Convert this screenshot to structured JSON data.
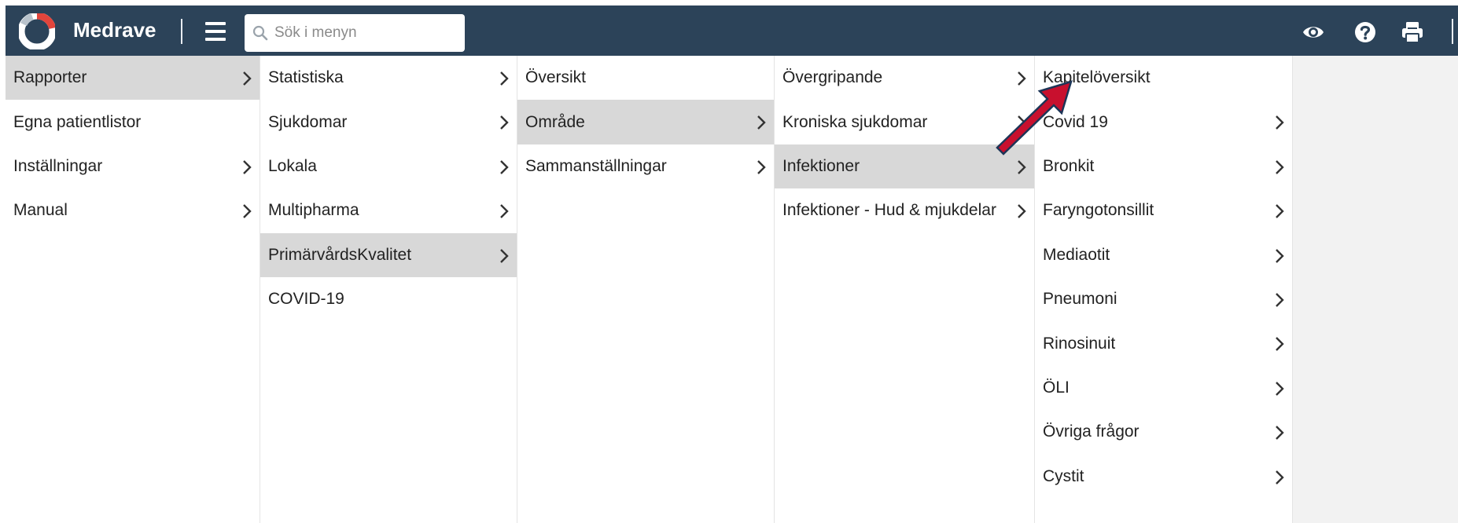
{
  "header": {
    "brand": "Medrave",
    "search_placeholder": "Sök i menyn",
    "icons": [
      "logo",
      "menu-icon",
      "search-icon",
      "eye-icon",
      "help-icon",
      "print-icon"
    ],
    "colors": {
      "bar": "#2c4359",
      "logo_red": "#e2453c",
      "active": "#d8d8d8",
      "arrow": "#c8102e"
    }
  },
  "menu": {
    "col1": [
      {
        "label": "Rapporter",
        "chevron": true,
        "active": true
      },
      {
        "label": "Egna patientlistor",
        "chevron": false
      },
      {
        "label": "Inställningar",
        "chevron": true
      },
      {
        "label": "Manual",
        "chevron": true
      }
    ],
    "col2": [
      {
        "label": "Statistiska",
        "chevron": true
      },
      {
        "label": "Sjukdomar",
        "chevron": true
      },
      {
        "label": "Lokala",
        "chevron": true
      },
      {
        "label": "Multipharma",
        "chevron": true
      },
      {
        "label": "PrimärvårdsKvalitet",
        "chevron": true,
        "active": true
      },
      {
        "label": "COVID-19",
        "chevron": false
      }
    ],
    "col3": [
      {
        "label": "Översikt",
        "chevron": false
      },
      {
        "label": "Område",
        "chevron": true,
        "active": true
      },
      {
        "label": "Sammanställningar",
        "chevron": true
      }
    ],
    "col4": [
      {
        "label": "Övergripande",
        "chevron": true
      },
      {
        "label": "Kroniska sjukdomar",
        "chevron": true
      },
      {
        "label": "Infektioner",
        "chevron": true,
        "active": true
      },
      {
        "label": "Infektioner - Hud & mjukdelar",
        "chevron": true
      }
    ],
    "col5": [
      {
        "label": "Kapitelöversikt",
        "chevron": false
      },
      {
        "label": "Covid 19",
        "chevron": true
      },
      {
        "label": "Bronkit",
        "chevron": true
      },
      {
        "label": "Faryngotonsillit",
        "chevron": true
      },
      {
        "label": "Mediaotit",
        "chevron": true
      },
      {
        "label": "Pneumoni",
        "chevron": true
      },
      {
        "label": "Rinosinuit",
        "chevron": true
      },
      {
        "label": "ÖLI",
        "chevron": true
      },
      {
        "label": "Övriga frågor",
        "chevron": true
      },
      {
        "label": "Cystit",
        "chevron": true
      }
    ]
  }
}
